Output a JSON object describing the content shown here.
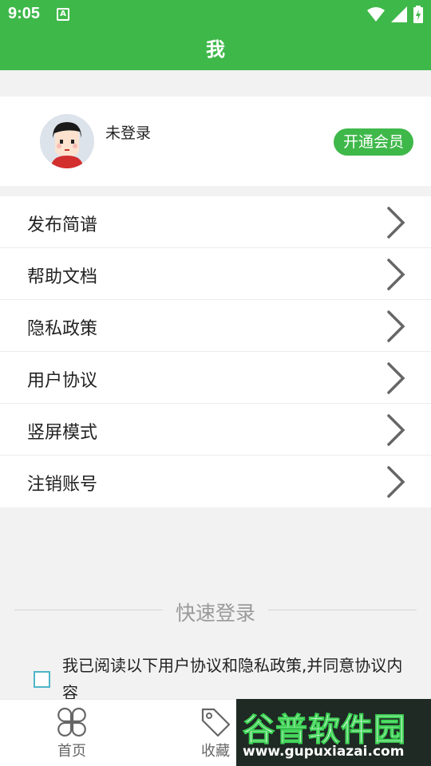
{
  "status_bar": {
    "time": "9:05",
    "notification_glyph": "A"
  },
  "app_bar": {
    "title": "我"
  },
  "profile": {
    "username": "未登录",
    "vip_button": "开通会员"
  },
  "menu": {
    "items": [
      {
        "label": "发布简谱"
      },
      {
        "label": "帮助文档"
      },
      {
        "label": "隐私政策"
      },
      {
        "label": "用户协议"
      },
      {
        "label": "竖屏模式"
      },
      {
        "label": "注销账号"
      }
    ]
  },
  "quick_login": {
    "title": "快速登录",
    "agreement_text": "我已阅读以下用户协议和隐私政策,并同意协议内容"
  },
  "tab_bar": {
    "tabs": [
      {
        "label": "首页",
        "icon": "clover-grid-icon"
      },
      {
        "label": "收藏",
        "icon": "tag-icon"
      }
    ]
  },
  "watermark": {
    "title": "谷普软件园",
    "url": "www.gupuxiazai.com"
  },
  "colors": {
    "accent": "#3fb84a",
    "checkbox": "#4db6c8"
  }
}
